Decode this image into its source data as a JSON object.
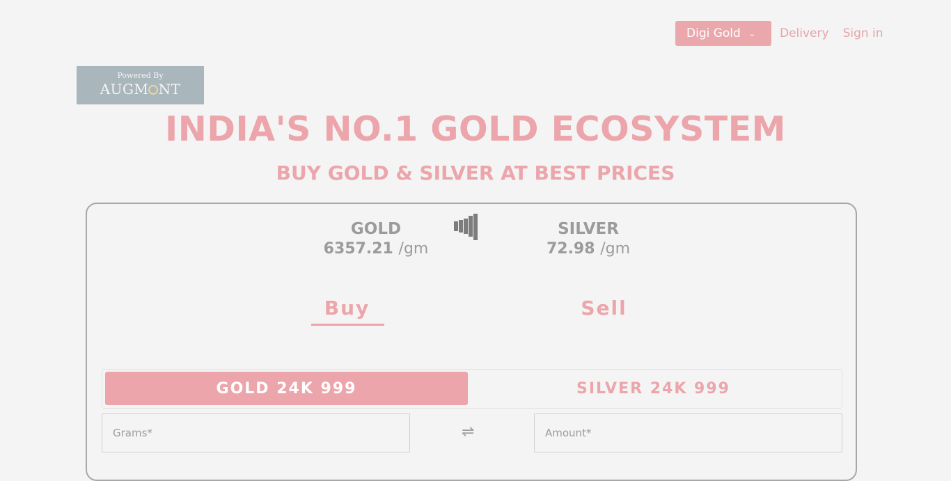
{
  "nav": {
    "dropdown_label": "Digi Gold",
    "delivery_label": "Delivery",
    "signin_label": "Sign in"
  },
  "logo": {
    "powered_by": "Powered By",
    "name_part1": "AUGM",
    "name_part2": "NT"
  },
  "hero": {
    "title": "INDIA'S NO.1 GOLD ECOSYSTEM",
    "subtitle": "BUY GOLD & SILVER AT BEST PRICES"
  },
  "prices": {
    "gold": {
      "metal": "GOLD",
      "value": "6357.21",
      "unit": "/gm"
    },
    "silver": {
      "metal": "SILVER",
      "value": "72.98",
      "unit": "/gm"
    }
  },
  "tabs": {
    "buy": "Buy",
    "sell": "Sell",
    "active": "Buy"
  },
  "metal_toggle": {
    "gold": "GOLD 24K 999",
    "silver": "SILVER 24K 999",
    "active": "GOLD 24K 999"
  },
  "form": {
    "grams_placeholder": "Grams*",
    "amount_placeholder": "Amount*"
  },
  "icons": {
    "dropdown": "chevron-down-icon",
    "signal": "signal-bars-icon",
    "swap": "swap-arrows-icon"
  },
  "colors": {
    "accent": "#eba5ab",
    "background": "#f4f4f4",
    "logo_bg": "#a9b6bc",
    "price_text": "#9b9b9b"
  }
}
